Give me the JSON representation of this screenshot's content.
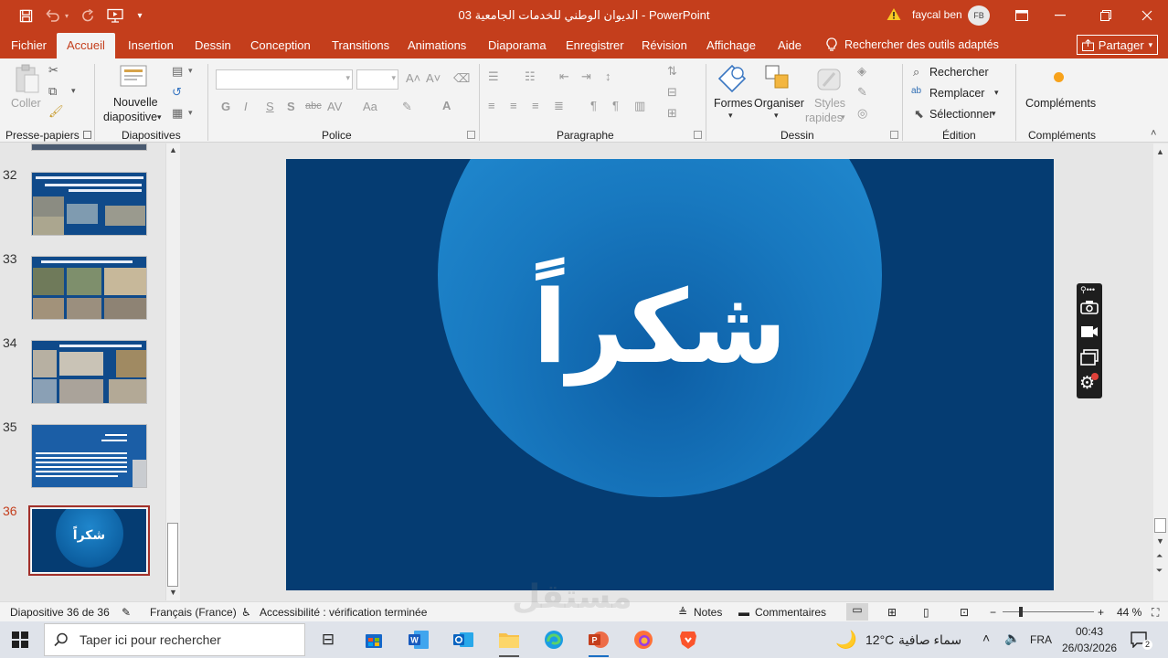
{
  "window": {
    "title": "الديوان الوطني للخدمات الجامعية 03  -  PowerPoint",
    "user": "faycal ben",
    "avatar": "FB"
  },
  "tabs": [
    "Fichier",
    "Accueil",
    "Insertion",
    "Dessin",
    "Conception",
    "Transitions",
    "Animations",
    "Diaporama",
    "Enregistrer",
    "Révision",
    "Affichage",
    "Aide"
  ],
  "search_tools": "Rechercher des outils adaptés",
  "share_label": "Partager",
  "ribbon": {
    "clipboard": {
      "paste": "Coller",
      "label": "Presse-papiers"
    },
    "slides": {
      "new_slide_l1": "Nouvelle",
      "new_slide_l2": "diapositive",
      "label": "Diapositives"
    },
    "font": {
      "label": "Police",
      "bold": "G",
      "italic": "I",
      "underline": "S",
      "shadow": "S",
      "strike": "abc",
      "case": "Aa"
    },
    "paragraph": {
      "label": "Paragraphe"
    },
    "drawing": {
      "shapes": "Formes",
      "arrange": "Organiser",
      "styles_l1": "Styles",
      "styles_l2": "rapides",
      "label": "Dessin"
    },
    "editing": {
      "find": "Rechercher",
      "replace": "Remplacer",
      "select": "Sélectionner",
      "label": "Édition"
    },
    "addins": {
      "button": "Compléments",
      "label": "Compléments"
    }
  },
  "thumbnails": [
    {
      "num": "32"
    },
    {
      "num": "33"
    },
    {
      "num": "34"
    },
    {
      "num": "35"
    },
    {
      "num": "36",
      "text": "شكراً",
      "selected": true
    }
  ],
  "slide": {
    "text": "شكراً",
    "bg": "#053c72"
  },
  "status": {
    "slide_info": "Diapositive 36 de 36",
    "language": "Français (France)",
    "accessibility": "Accessibilité : vérification terminée",
    "notes": "Notes",
    "comments": "Commentaires",
    "zoom": "44 %"
  },
  "taskbar": {
    "search_placeholder": "Taper ici pour rechercher",
    "weather_temp": "12°C",
    "weather_text": "سماء صافية",
    "lang": "FRA",
    "time": "00:43",
    "date": "26/03/2026",
    "notif_count": "2"
  },
  "watermark": "مستقل",
  "colors": {
    "accent": "#c43e1c",
    "slide_bg": "#053c72",
    "circle": "#1a7fc4"
  }
}
